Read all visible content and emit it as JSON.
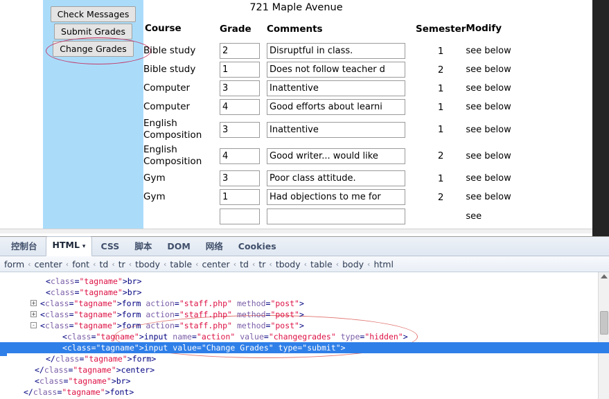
{
  "page": {
    "title": "721 Maple Avenue",
    "sidebar": {
      "buttons": [
        {
          "label": "Check Messages"
        },
        {
          "label": "Submit Grades"
        },
        {
          "label": "Change Grades"
        }
      ]
    },
    "table": {
      "headers": {
        "course": "Course",
        "grade": "Grade",
        "comments": "Comments",
        "semester": "Semester",
        "modify": "Modify"
      },
      "modify_text": "see below",
      "rows": [
        {
          "course": "Bible study",
          "grade": "2",
          "comment": "Disruptful in class.",
          "semester": "1",
          "modify": "see below"
        },
        {
          "course": "Bible study",
          "grade": "1",
          "comment": "Does not follow teacher d",
          "semester": "2",
          "modify": "see below"
        },
        {
          "course": "Computer",
          "grade": "3",
          "comment": "Inattentive",
          "semester": "1",
          "modify": "see below"
        },
        {
          "course": "Computer",
          "grade": "4",
          "comment": "Good efforts about learni",
          "semester": "1",
          "modify": "see below"
        },
        {
          "course": "English Composition",
          "grade": "3",
          "comment": "Inattentive",
          "semester": "1",
          "modify": "see below"
        },
        {
          "course": "English Composition",
          "grade": "4",
          "comment": "Good writer... would like",
          "semester": "2",
          "modify": "see below"
        },
        {
          "course": "Gym",
          "grade": "3",
          "comment": "Poor class attitude.",
          "semester": "1",
          "modify": "see below"
        },
        {
          "course": "Gym",
          "grade": "1",
          "comment": "Had objections to me for",
          "semester": "2",
          "modify": "see below"
        },
        {
          "course": "",
          "grade": "",
          "comment": "",
          "semester": "",
          "modify": "see"
        }
      ]
    }
  },
  "devtools": {
    "tabs": [
      {
        "label": "控制台",
        "active": false,
        "caret": ""
      },
      {
        "label": "HTML",
        "active": true,
        "caret": "▾"
      },
      {
        "label": "CSS",
        "active": false,
        "caret": ""
      },
      {
        "label": "脚本",
        "active": false,
        "caret": ""
      },
      {
        "label": "DOM",
        "active": false,
        "caret": ""
      },
      {
        "label": "网络",
        "active": false,
        "caret": ""
      },
      {
        "label": "Cookies",
        "active": false,
        "caret": ""
      }
    ],
    "breadcrumb": [
      "form",
      "center",
      "font",
      "td",
      "tr",
      "tbody",
      "table",
      "center",
      "td",
      "tr",
      "tbody",
      "table",
      "body",
      "html"
    ],
    "breadcrumb_separator": "‹",
    "source_lines": [
      {
        "indent": 6,
        "twisty": "",
        "text": "<br>",
        "selected": false
      },
      {
        "indent": 6,
        "twisty": "",
        "text": "<br>",
        "selected": false
      },
      {
        "indent": 5,
        "twisty": "+",
        "text": "<form action=\"staff.php\" method=\"post\">",
        "selected": false
      },
      {
        "indent": 5,
        "twisty": "+",
        "text": "<form action=\"staff.php\" method=\"post\">",
        "selected": false
      },
      {
        "indent": 5,
        "twisty": "-",
        "text": "<form action=\"staff.php\" method=\"post\">",
        "selected": false
      },
      {
        "indent": 9,
        "twisty": "",
        "text": "<input name=\"action\" value=\"changegrades\" type=\"hidden\">",
        "selected": false
      },
      {
        "indent": 9,
        "twisty": "",
        "text": "<input value=\"Change Grades\" type=\"submit\">",
        "selected": true
      },
      {
        "indent": 6,
        "twisty": "",
        "text": "</form>",
        "selected": false
      },
      {
        "indent": 4,
        "twisty": "",
        "text": "</center>",
        "selected": false
      },
      {
        "indent": 4,
        "twisty": "",
        "text": "<br>",
        "selected": false
      },
      {
        "indent": 2,
        "twisty": "",
        "text": "</font>",
        "selected": false
      }
    ]
  },
  "colors": {
    "sidebar_blue": "#aadcfa",
    "annotation_red": "#c43a6a",
    "annotation_code_red": "#e0736e",
    "selection_blue": "#2f7fe8"
  }
}
